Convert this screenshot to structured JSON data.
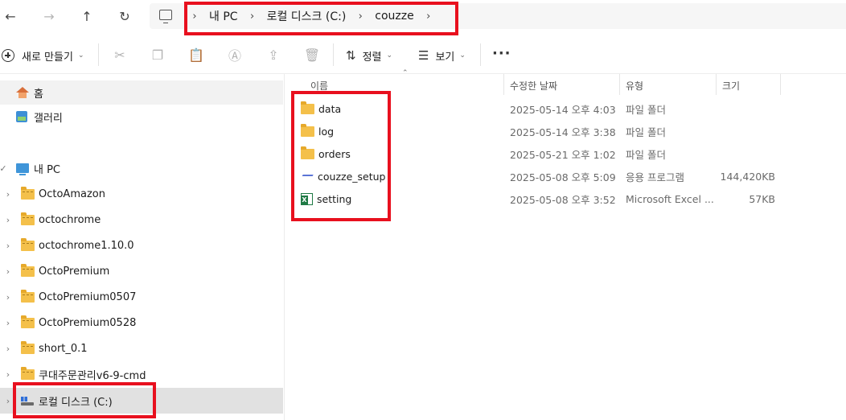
{
  "breadcrumb": [
    "내 PC",
    "로컬 디스크 (C:)",
    "couzze"
  ],
  "toolbar": {
    "new_label": "새로 만들기",
    "sort_label": "정렬",
    "view_label": "보기",
    "more_label": "···"
  },
  "sidebar": {
    "quick": [
      {
        "label": "홈",
        "icon": "home-icon"
      },
      {
        "label": "갤러리",
        "icon": "gallery-icon"
      }
    ],
    "this_pc": "내 PC",
    "folders": [
      "OctoAmazon",
      "octochrome",
      "octochrome1.10.0",
      "OctoPremium",
      "OctoPremium0507",
      "OctoPremium0528",
      "short_0.1",
      "쿠대주문관리v6-9-cmd"
    ],
    "drive": "로컬 디스크 (C:)"
  },
  "columns": {
    "name": "이름",
    "modified": "수정한 날짜",
    "type": "유형",
    "size": "크기"
  },
  "files": [
    {
      "name": "data",
      "modified": "2025-05-14 오후 4:03",
      "type": "파일 폴더",
      "size": "",
      "icon": "folder-icon"
    },
    {
      "name": "log",
      "modified": "2025-05-14 오후 3:38",
      "type": "파일 폴더",
      "size": "",
      "icon": "folder-icon"
    },
    {
      "name": "orders",
      "modified": "2025-05-21 오후 1:02",
      "type": "파일 폴더",
      "size": "",
      "icon": "folder-icon"
    },
    {
      "name": "couzze_setup",
      "modified": "2025-05-08 오후 5:09",
      "type": "응용 프로그램",
      "size": "144,420KB",
      "icon": "setup-icon"
    },
    {
      "name": "setting",
      "modified": "2025-05-08 오후 3:52",
      "type": "Microsoft Excel ...",
      "size": "57KB",
      "icon": "excel-icon"
    }
  ],
  "colors": {
    "highlight_box": "#e8101e",
    "selected_row": "#e1e1e1",
    "folder": "#f4c04a"
  }
}
